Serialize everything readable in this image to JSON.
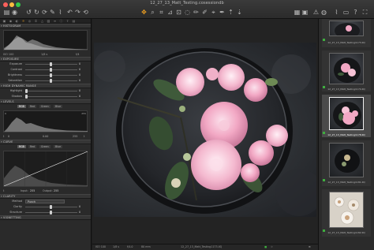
{
  "window": {
    "title": "12_27_13_Matt_Testing.cosessiondb"
  },
  "toolbar": {
    "icons": [
      "import-icon",
      "capture-icon",
      "undo-icon",
      "redo-icon",
      "rotate-icon",
      "crop-icon",
      "straighten-icon",
      "keystone-icon",
      "spot-icon",
      "picker-icon",
      "cursor-icon",
      "copy-adjust-icon",
      "apply-adjust-icon",
      "grid-icon",
      "proof-icon",
      "warning-icon",
      "loupe-icon",
      "help-icon"
    ]
  },
  "left_panel": {
    "histogram": {
      "title": "HISTOGRAM",
      "iso": "ISO 100",
      "shutter": "1/8 s",
      "aperture": "f/4"
    },
    "exposure": {
      "title": "EXPOSURE",
      "sliders": [
        {
          "label": "Exposure",
          "value": "0",
          "level": 0.5
        },
        {
          "label": "Contrast",
          "value": "0",
          "level": 0.5
        },
        {
          "label": "Brightness",
          "value": "0",
          "level": 0.5
        },
        {
          "label": "Saturation",
          "value": "0",
          "level": 0.5
        }
      ]
    },
    "hdr": {
      "title": "HIGH DYNAMIC RANGE",
      "sliders": [
        {
          "label": "Highlight",
          "value": "0",
          "level": 0.0
        },
        {
          "label": "Shadow",
          "value": "0",
          "level": 0.0
        }
      ]
    },
    "levels": {
      "title": "LEVELS",
      "tabs": [
        "RGB",
        "Red",
        "Green",
        "Blue"
      ],
      "left_value": "0",
      "right_value": "255",
      "bottom_left": "0",
      "bottom_mid": "0.00",
      "bottom_right": "255"
    },
    "curve": {
      "title": "CURVE",
      "tabs": [
        "RGB",
        "Red",
        "Green",
        "Blue"
      ],
      "input_label": "Input:",
      "input_value": "255",
      "output_label": "Output:",
      "output_value": "255"
    },
    "clarity": {
      "title": "CLARITY",
      "method_label": "Method",
      "method_value": "Punch",
      "sliders": [
        {
          "label": "Clarity",
          "value": "0",
          "level": 0.5
        },
        {
          "label": "Structure",
          "value": "0",
          "level": 0.5
        }
      ]
    },
    "vignetting": {
      "title": "VIGNETTING"
    }
  },
  "viewer": {
    "status_iso": "ISO 100",
    "status_shutter": "1/8 s",
    "status_aperture": "f/4.0",
    "status_focal": "80 mm",
    "status_filename": "12_27_13_Matt_Testing1173.IIQ"
  },
  "browser": {
    "thumbs": [
      {
        "label": "12_27_13_Matt_Testing1173.IIQ",
        "selected": false,
        "rating_color": "#3fae3f"
      },
      {
        "label": "12_27_13_Matt_Testing1174.IIQ",
        "selected": false,
        "rating_color": "#3fae3f"
      },
      {
        "label": "12_27_13_Matt_Testing1178.IIQ",
        "selected": true,
        "rating_color": "#3fae3f"
      },
      {
        "label": "12_27_13_Matt_Testing1181.IIQ",
        "selected": false,
        "rating_color": "#3fae3f"
      },
      {
        "label": "12_27_13_Matt_Testing1182.IIQ",
        "selected": false,
        "rating_color": "#3fae3f"
      }
    ]
  },
  "colors": {
    "accent": "#f0a020",
    "panel": "#2a2a2a",
    "viewer_bg": "#232323",
    "pink_flower": "#f2a8c4"
  }
}
